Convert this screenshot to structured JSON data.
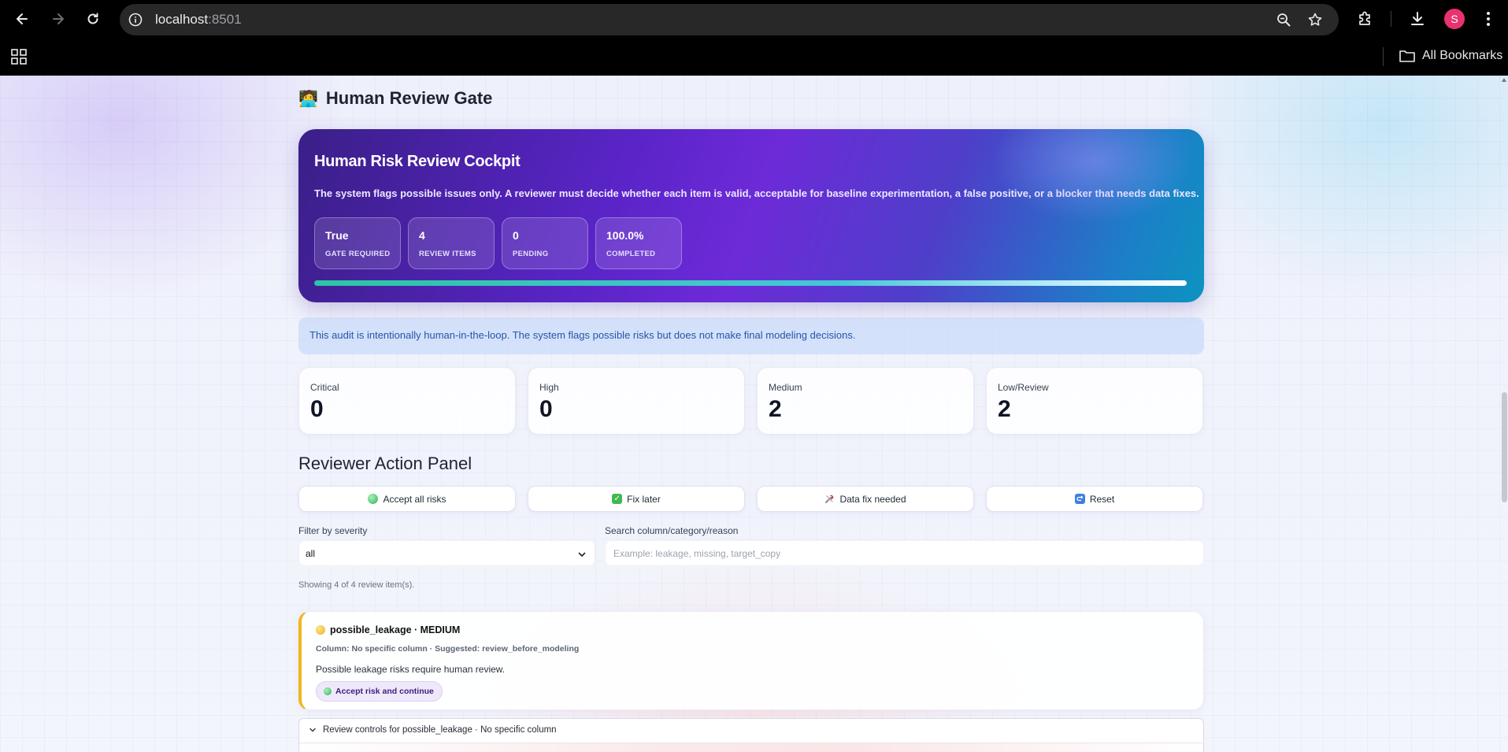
{
  "browser": {
    "url_host": "localhost",
    "url_port": ":8501",
    "avatar_letter": "S",
    "bookmarks_label": "All Bookmarks"
  },
  "page": {
    "gate_emoji": "🧑‍💻",
    "gate_title": "Human Review Gate"
  },
  "hero": {
    "title": "Human Risk Review Cockpit",
    "description": "The system flags possible issues only. A reviewer must decide whether each item is valid, acceptable for baseline experimentation, a false positive, or a blocker that needs data fixes.",
    "stats": [
      {
        "value": "True",
        "label": "GATE REQUIRED"
      },
      {
        "value": "4",
        "label": "REVIEW ITEMS"
      },
      {
        "value": "0",
        "label": "PENDING"
      },
      {
        "value": "100.0%",
        "label": "COMPLETED"
      }
    ],
    "progress_fraction": 1.0
  },
  "notice": "This audit is intentionally human-in-the-loop. The system flags possible risks but does not make final modeling decisions.",
  "severity_cards": [
    {
      "label": "Critical",
      "value": "0"
    },
    {
      "label": "High",
      "value": "0"
    },
    {
      "label": "Medium",
      "value": "2"
    },
    {
      "label": "Low/Review",
      "value": "2"
    }
  ],
  "panel": {
    "title": "Reviewer Action Panel",
    "actions": [
      {
        "label": "Accept all risks",
        "icon": "green-circle-icon",
        "color": "#34c05a"
      },
      {
        "label": "Fix later",
        "icon": "check-box-icon",
        "color": "#3fb950"
      },
      {
        "label": "Data fix needed",
        "icon": "tools-icon",
        "color": "#8a8a9a"
      },
      {
        "label": "Reset",
        "icon": "reset-arrow-icon",
        "color": "#3d7fe0"
      }
    ],
    "filter_label": "Filter by severity",
    "filter_value": "all",
    "search_label": "Search column/category/reason",
    "search_placeholder": "Example: leakage, missing, target_copy",
    "showing": "Showing 4 of 4 review item(s)."
  },
  "item": {
    "title": "possible_leakage · MEDIUM",
    "meta": "Column: No specific column · Suggested: review_before_modeling",
    "message": "Possible leakage risks require human review.",
    "button": "Accept risk and continue",
    "accent_color": "#f2b51d"
  },
  "expander": {
    "label": "Review controls for possible_leakage · No specific column"
  }
}
